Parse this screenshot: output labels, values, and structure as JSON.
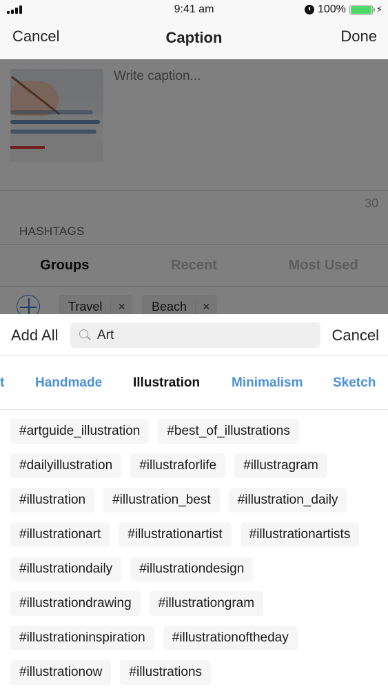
{
  "status_bar": {
    "time": "9:41 am",
    "battery_percent_label": "100%",
    "battery_level": 1.0,
    "icons": [
      "signal-icon",
      "alarm-icon",
      "battery-icon",
      "charging-bolt-icon"
    ]
  },
  "nav": {
    "cancel_label": "Cancel",
    "title": "Caption",
    "done_label": "Done"
  },
  "caption": {
    "placeholder": "Write caption...",
    "char_count": "30",
    "hashtags_label": "HASHTAGS",
    "tabs": [
      {
        "label": "Groups",
        "active": true
      },
      {
        "label": "Recent",
        "active": false
      },
      {
        "label": "Most Used",
        "active": false
      }
    ],
    "groups": [
      {
        "label": "Travel",
        "remove": "×"
      },
      {
        "label": "Beach",
        "remove": "×"
      }
    ]
  },
  "search": {
    "add_all_label": "Add All",
    "value": "Art",
    "cancel_label": "Cancel",
    "categories": [
      {
        "label": "t",
        "active": false
      },
      {
        "label": "Handmade",
        "active": false
      },
      {
        "label": "Illustration",
        "active": true
      },
      {
        "label": "Minimalism",
        "active": false
      },
      {
        "label": "Sketch",
        "active": false
      }
    ],
    "hashtags": [
      "#artguide_illustration",
      "#best_of_illustrations",
      "#dailyillustration",
      "#illustraforlife",
      "#illustragram",
      "#illustration",
      "#illustration_best",
      "#illustration_daily",
      "#illustrationart",
      "#illustrationartist",
      "#illustrationartists",
      "#illustrationdaily",
      "#illustrationdesign",
      "#illustrationdrawing",
      "#illustrationgram",
      "#illustrationinspiration",
      "#illustrationoftheday",
      "#illustrationow",
      "#illustrations"
    ]
  },
  "colors": {
    "accent": "#4a90d9",
    "battery_green": "#4cd964",
    "chip_bg": "#f6f6f6"
  }
}
